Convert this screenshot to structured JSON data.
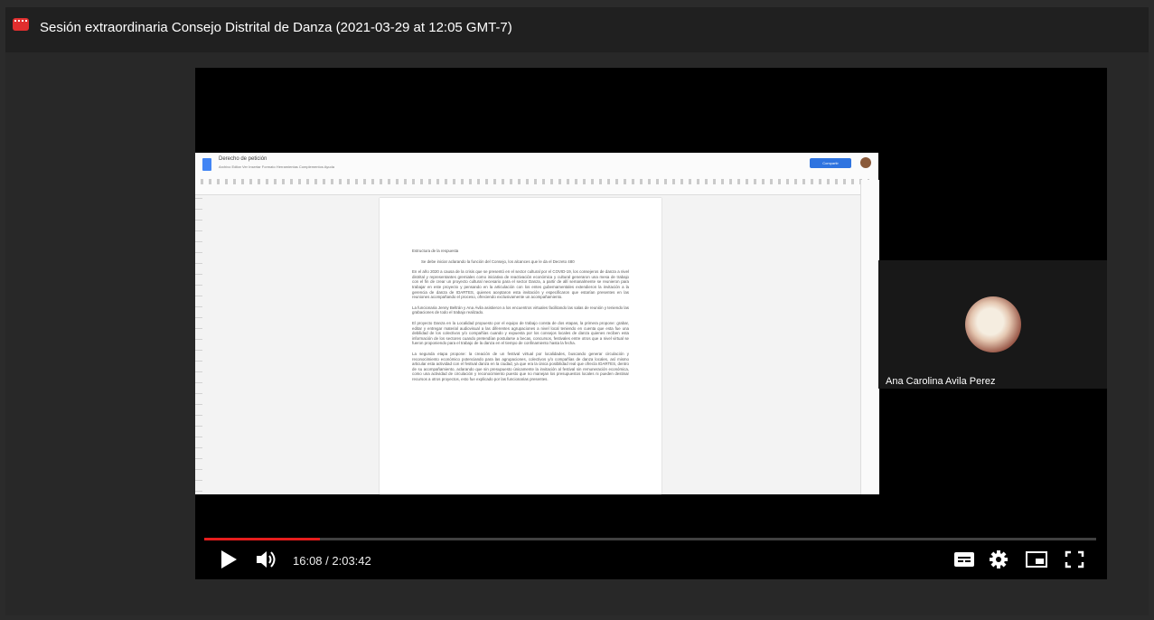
{
  "header": {
    "title": "Sesión extraordinaria Consejo Distrital de Danza (2021-03-29 at 12:05 GMT-7)",
    "logo_icon": "video-file-icon"
  },
  "shared_screen": {
    "doc_title": "Derecho de petición",
    "doc_menu": "Archivo  Editar  Ver  Insertar  Formato  Herramientas  Complementos  Ayuda",
    "share_button": "Compartir",
    "paragraphs": [
      "Estructura de la respuesta",
      "Se debe iniciar aclarando la función del Consejo, los alcances que le da el Decreto 480",
      "En el año 2020 a causa de la crisis que se presentó en el sector cultural por el COVID-19, los consejeros de danza a nivel distrital y representantes gremiales como iniciativa de reactivación económica y cultural generaron una mesa de trabajo con el fin de crear un proyecto cultural necesario para el sector Danza, a partir de allí semanalmente se reunieron para trabajar en este proyecto y pensando en la articulación con los entes gubernamentales extendieron la invitación a la gerencia de danza de IDARTES, quienes aceptaron esta invitación y especificaron que estarían presentes en las reuniones acompañando el proceso, ofreciendo exclusivamente un acompañamiento.",
      "La funcionaria Jenny Beltrán y Ana Ávila asistieron a los encuentros virtuales facilitando las salas de reunión y teniendo las grabaciones de todo el trabajo realizado.",
      "El proyecto Danza en la Localidad propuesto por el equipo de trabajo consta de dos etapas, la primera propone: grabar, editar y entregar material audiovisual a las diferentes agrupaciones a nivel local teniendo en cuenta que esta fue una debilidad de los colectivos y/o compañías cuando y expuesta por los consejos locales de danza quienes reciben esta información de los sectores cuando pretendían postularse a becas, concursos, festivales entre otros que a nivel virtual se fueron proponiendo para el trabajo de la danza en el tiempo de confinamiento hasta la fecha.",
      "La segunda etapa propone: la creación de un festival virtual por localidades, buscando generar circulación y reconocimiento económico potenciando para las agrupaciones, colectivos y/o compañías de danza locales, así mismo articular esta actividad con el festival danza en la ciudad, ya que era la única posibilidad real que ofrecía IDARTES, dentro de su acompañamiento, aclarando que sin presupuesto únicamente la invitación al festival sin remuneración económica, como una actividad de circulación y reconocimiento puesto que no manejan los presupuestos locales ni pueden destinar recursos a otros proyectos, esto fue explicado por las funcionarias presentes."
    ]
  },
  "participant": {
    "name": "Ana Carolina Avila Perez"
  },
  "controls": {
    "current_time": "16:08",
    "duration": "2:03:42",
    "time_display": "16:08 / 2:03:42",
    "progress_fraction": 0.13,
    "progress_color": "#e61d1d"
  }
}
